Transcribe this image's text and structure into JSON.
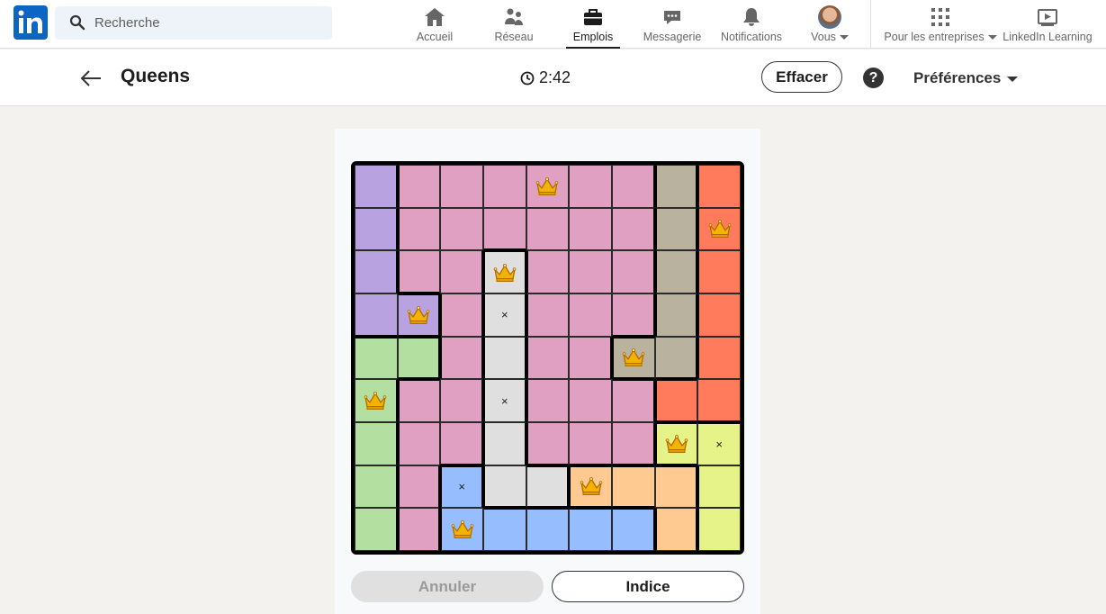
{
  "nav": {
    "logo_text": "in",
    "search_placeholder": "Recherche",
    "items": [
      {
        "label": "Accueil",
        "icon": "home-icon"
      },
      {
        "label": "Réseau",
        "icon": "network-icon"
      },
      {
        "label": "Emplois",
        "icon": "briefcase-icon",
        "active": true
      },
      {
        "label": "Messagerie",
        "icon": "message-icon"
      },
      {
        "label": "Notifications",
        "icon": "bell-icon"
      },
      {
        "label": "Vous",
        "icon": "avatar"
      },
      {
        "label": "Pour les entreprises",
        "icon": "grid-icon"
      },
      {
        "label": "LinkedIn Learning",
        "icon": "learning-icon"
      }
    ]
  },
  "header": {
    "title": "Queens",
    "timer": "2:42",
    "clear_label": "Effacer",
    "help_label": "?",
    "prefs_label": "Préférences"
  },
  "board": {
    "size": 9,
    "colors": {
      "A": "#b9a2e0",
      "B": "#dfa0c1",
      "C": "#b9b29e",
      "D": "#ff7b5b",
      "E": "#dfdfdf",
      "F": "#b3dfa0",
      "G": "#e6f388",
      "H": "#96bdfe",
      "I": "#ffc992"
    },
    "regions": [
      "ABBBBBBCD",
      "ABBBBBBCD",
      "ABBEBBBCD",
      "AABEBBBCD",
      "FFBEBBCCD",
      "FBBEBBBDD",
      "FBBEBBBGG",
      "FBHEEIIIG",
      "FBHHHHHIG"
    ],
    "queens": [
      [
        0,
        4
      ],
      [
        1,
        8
      ],
      [
        2,
        3
      ],
      [
        3,
        1
      ],
      [
        4,
        6
      ],
      [
        5,
        0
      ],
      [
        6,
        7
      ],
      [
        7,
        5
      ],
      [
        8,
        2
      ]
    ],
    "marks": [
      [
        3,
        3
      ],
      [
        5,
        3
      ],
      [
        6,
        8
      ],
      [
        7,
        2
      ]
    ]
  },
  "actions": {
    "undo_label": "Annuler",
    "hint_label": "Indice"
  }
}
